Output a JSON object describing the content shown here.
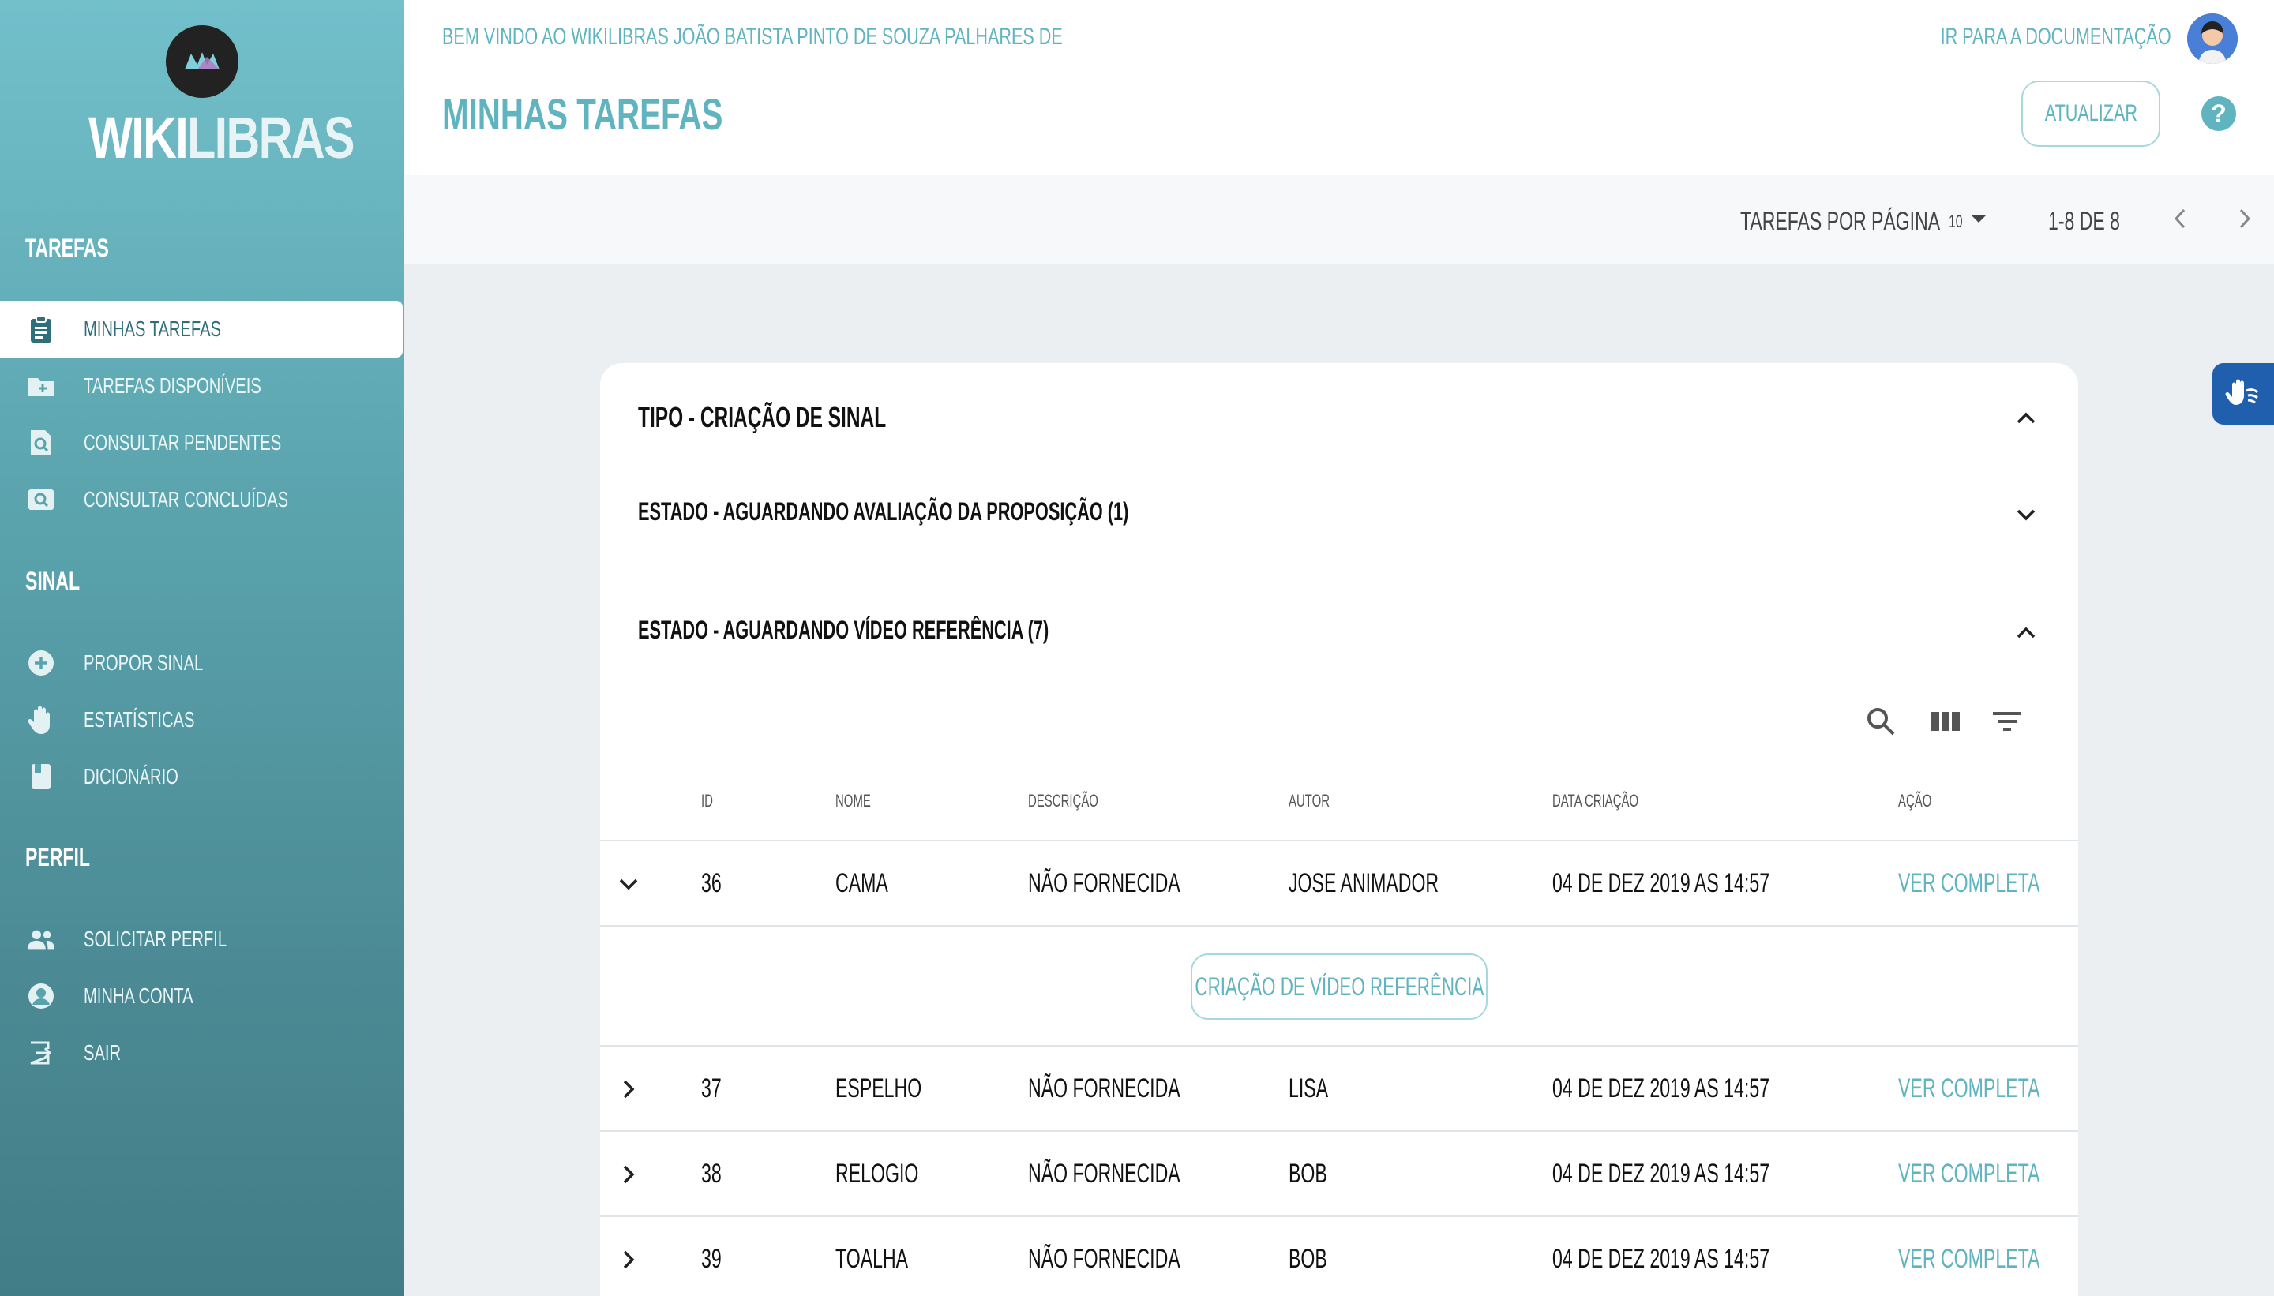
{
  "sidebar": {
    "logo": {
      "wiki": "WIKI",
      "libras": "LIBRAS"
    },
    "sections": [
      {
        "title": "TAREFAS",
        "items": [
          {
            "label": "MINHAS TAREFAS",
            "icon": "clipboard-icon",
            "active": true
          },
          {
            "label": "TAREFAS DISPONÍVEIS",
            "icon": "folder-plus-icon"
          },
          {
            "label": "CONSULTAR PENDENTES",
            "icon": "search-file-icon"
          },
          {
            "label": "CONSULTAR CONCLUÍDAS",
            "icon": "search-image-icon"
          }
        ]
      },
      {
        "title": "SINAL",
        "items": [
          {
            "label": "PROPOR SINAL",
            "icon": "plus-circle-icon"
          },
          {
            "label": "ESTATÍSTICAS",
            "icon": "hand-icon"
          },
          {
            "label": "DICIONÁRIO",
            "icon": "book-icon"
          }
        ]
      },
      {
        "title": "PERFIL",
        "items": [
          {
            "label": "SOLICITAR PERFIL",
            "icon": "people-icon"
          },
          {
            "label": "MINHA CONTA",
            "icon": "account-icon"
          },
          {
            "label": "SAIR",
            "icon": "logout-icon"
          }
        ]
      }
    ]
  },
  "header": {
    "welcome": "BEM VINDO AO WIKILIBRAS JOÃO BATISTA PINTO DE SOUZA PALHARES DE",
    "title": "MINHAS TAREFAS",
    "doc_link": "IR PARA A DOCUMENTAÇÃO",
    "refresh_label": "ATUALIZAR",
    "help_label": "?"
  },
  "pager": {
    "per_page_label": "TAREFAS POR PÁGINA",
    "per_page_value": "10",
    "range": "1-8 DE 8"
  },
  "card": {
    "type_heading": "TIPO - CRIAÇÃO DE SINAL",
    "state1_heading": "ESTADO - AGUARDANDO AVALIAÇÃO DA PROPOSIÇÃO (1)",
    "state2_heading": "ESTADO - AGUARDANDO VÍDEO REFERÊNCIA (7)",
    "columns": {
      "id": "ID",
      "name": "NOME",
      "desc": "DESCRIÇÃO",
      "author": "AUTOR",
      "date": "DATA CRIAÇÃO",
      "action": "AÇÃO"
    },
    "expanded_action": "CRIAÇÃO DE VÍDEO REFERÊNCIA",
    "rows": [
      {
        "id": "36",
        "name": "CAMA",
        "desc": "NÃO FORNECIDA",
        "author": "JOSE ANIMADOR",
        "date": "04 DE DEZ 2019 AS 14:57",
        "action": "VER COMPLETA"
      },
      {
        "id": "37",
        "name": "ESPELHO",
        "desc": "NÃO FORNECIDA",
        "author": "LISA",
        "date": "04 DE DEZ 2019 AS 14:57",
        "action": "VER COMPLETA"
      },
      {
        "id": "38",
        "name": "RELOGIO",
        "desc": "NÃO FORNECIDA",
        "author": "BOB",
        "date": "04 DE DEZ 2019 AS 14:57",
        "action": "VER COMPLETA"
      },
      {
        "id": "39",
        "name": "TOALHA",
        "desc": "NÃO FORNECIDA",
        "author": "BOB",
        "date": "04 DE DEZ 2019 AS 14:57",
        "action": "VER COMPLETA"
      }
    ]
  },
  "colors": {
    "accent": "#5fb4c0",
    "sidebar_top": "#72c0cb",
    "sidebar_bottom": "#427d87",
    "a11y": "#1f5fae"
  }
}
